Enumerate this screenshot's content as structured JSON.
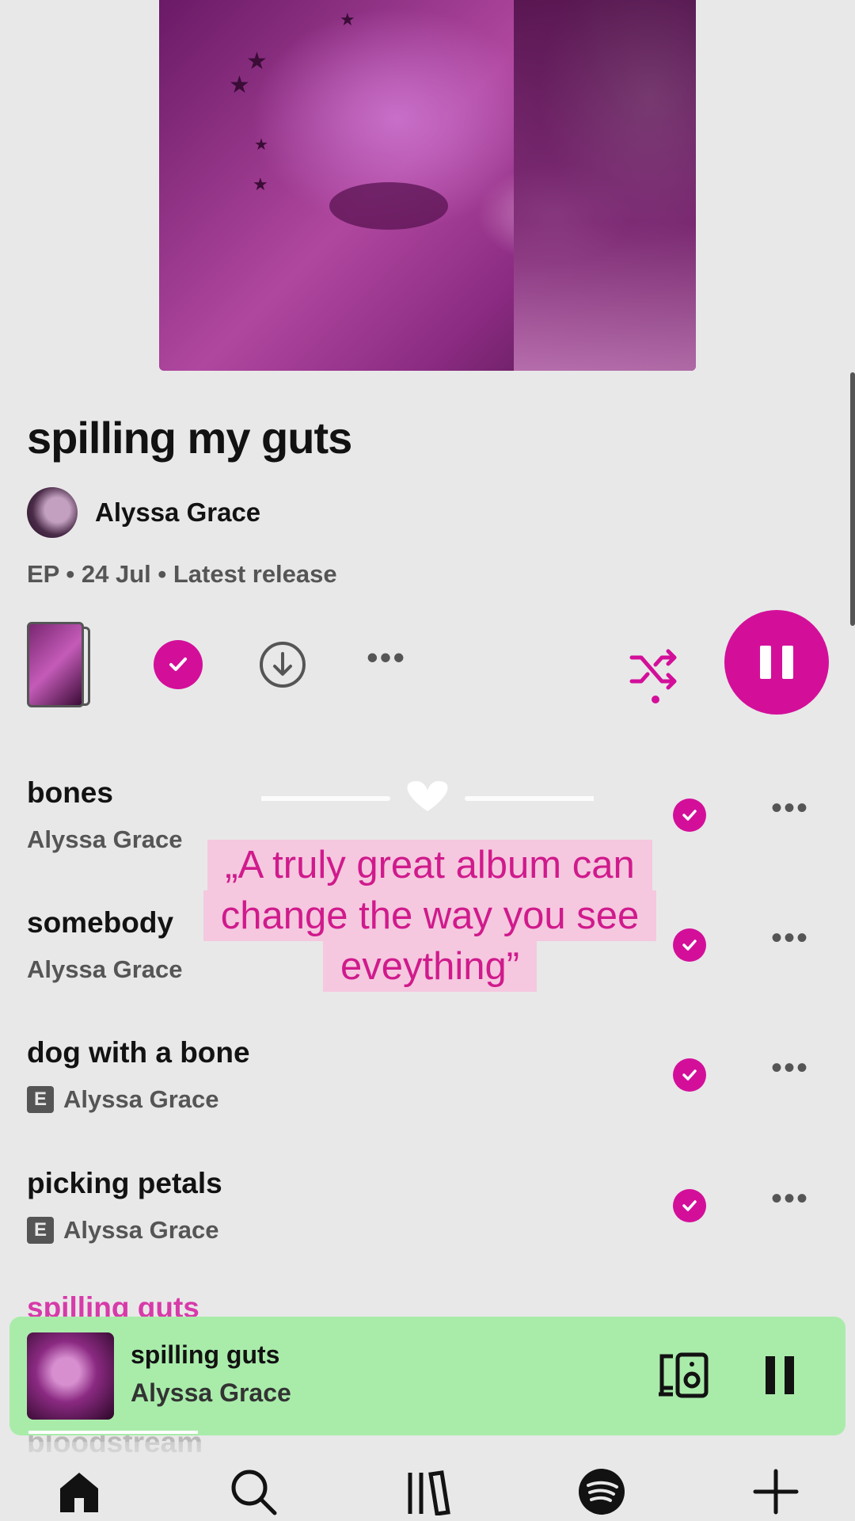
{
  "album": {
    "title": "spilling my guts",
    "artist": "Alyssa Grace",
    "meta": "EP • 24 Jul • Latest release"
  },
  "colors": {
    "accent": "#d30f9a",
    "mini_player_bg": "#a9ecaa",
    "background": "#e8e8e8",
    "quote_bg": "#f5c8df"
  },
  "controls": {
    "saved_icon": "check-circle-icon",
    "download_icon": "download-icon",
    "more_icon": "more-icon",
    "shuffle_icon": "shuffle-icon",
    "play_state_icon": "pause-icon"
  },
  "tracks": [
    {
      "title": "bones",
      "artist": "Alyssa Grace",
      "explicit": false,
      "saved": true
    },
    {
      "title": "somebody",
      "artist": "Alyssa Grace",
      "explicit": false,
      "saved": true
    },
    {
      "title": "dog with a bone",
      "artist": "Alyssa Grace",
      "explicit": true,
      "saved": true
    },
    {
      "title": "picking petals",
      "artist": "Alyssa Grace",
      "explicit": true,
      "saved": true
    }
  ],
  "explicit_label": "E",
  "more_dots": "•••",
  "partial_tracks": [
    "spilling guts",
    "bloodstream"
  ],
  "quote": {
    "line1": "„A truly great album can",
    "line2": "change the way you see",
    "line3": "eveything”"
  },
  "mini_player": {
    "title": "spilling guts",
    "artist": "Alyssa Grace",
    "device_icon": "connect-device-icon",
    "state_icon": "pause-icon"
  },
  "nav": [
    "home-icon",
    "search-icon",
    "library-icon",
    "spotify-icon",
    "create-icon"
  ]
}
